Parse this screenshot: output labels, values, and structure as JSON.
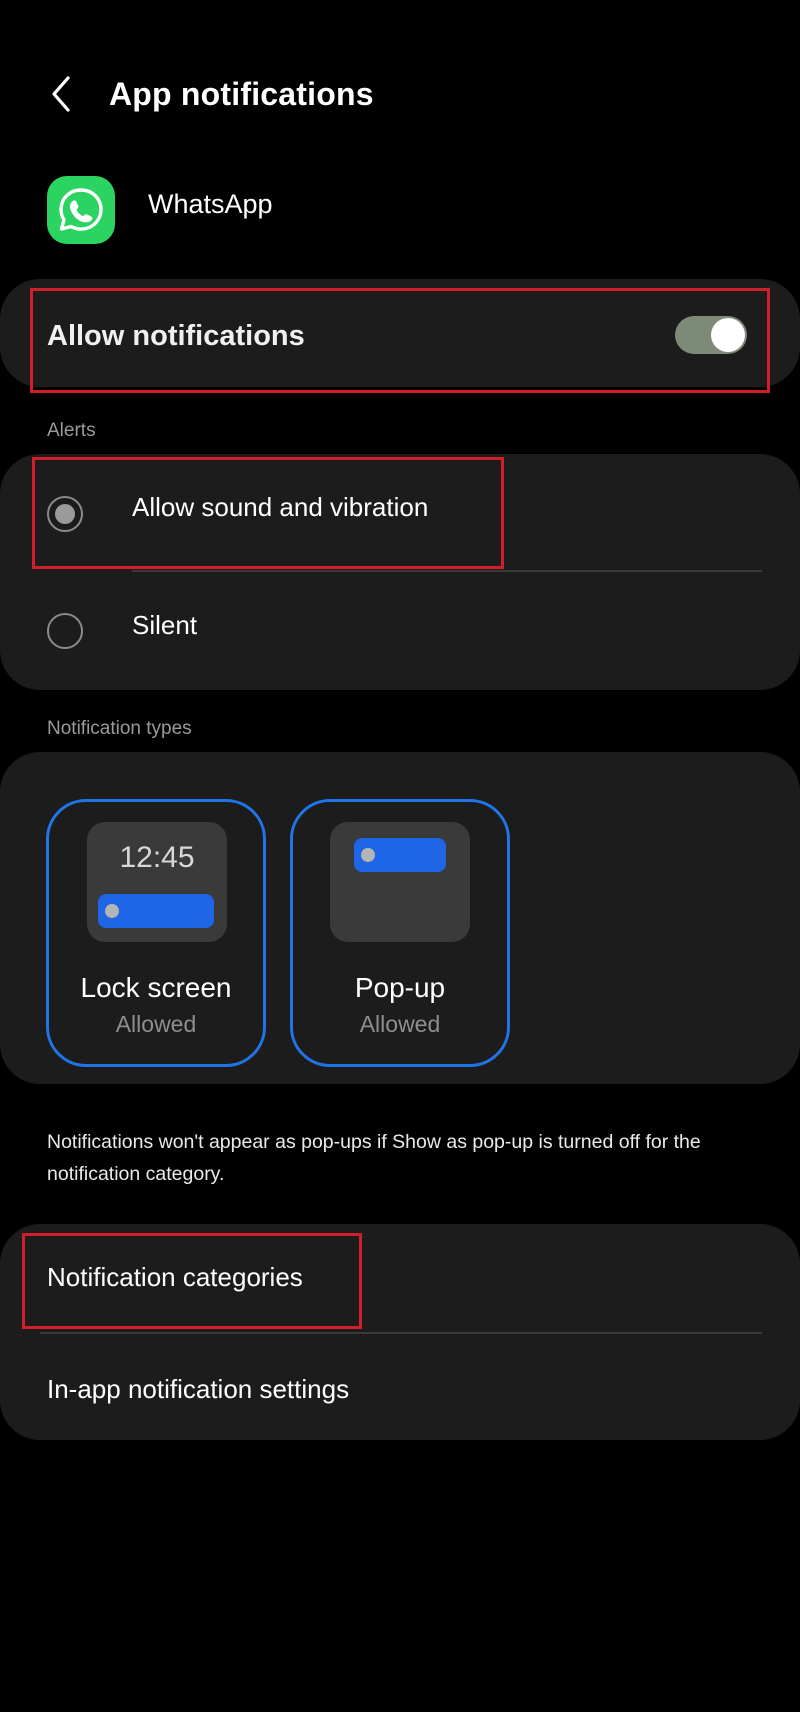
{
  "header": {
    "title": "App notifications",
    "back_icon": "chevron-left-icon"
  },
  "app": {
    "name": "WhatsApp",
    "icon": "whatsapp-icon",
    "icon_color": "#2bd361"
  },
  "allow_notifications": {
    "label": "Allow notifications",
    "enabled": true
  },
  "alerts": {
    "section_label": "Alerts",
    "options": [
      {
        "label": "Allow sound and vibration",
        "selected": true
      },
      {
        "label": "Silent",
        "selected": false
      }
    ]
  },
  "notification_types": {
    "section_label": "Notification types",
    "tiles": [
      {
        "title": "Lock screen",
        "status": "Allowed",
        "preview_time": "12:45"
      },
      {
        "title": "Pop-up",
        "status": "Allowed"
      }
    ],
    "accent_color": "#1f74e6"
  },
  "note": "Notifications won't appear as pop-ups if Show as pop-up is turned off for the notification category.",
  "categories": {
    "items": [
      {
        "label": "Notification categories"
      },
      {
        "label": "In-app notification settings"
      }
    ]
  },
  "highlight_color": "#d01f2a"
}
